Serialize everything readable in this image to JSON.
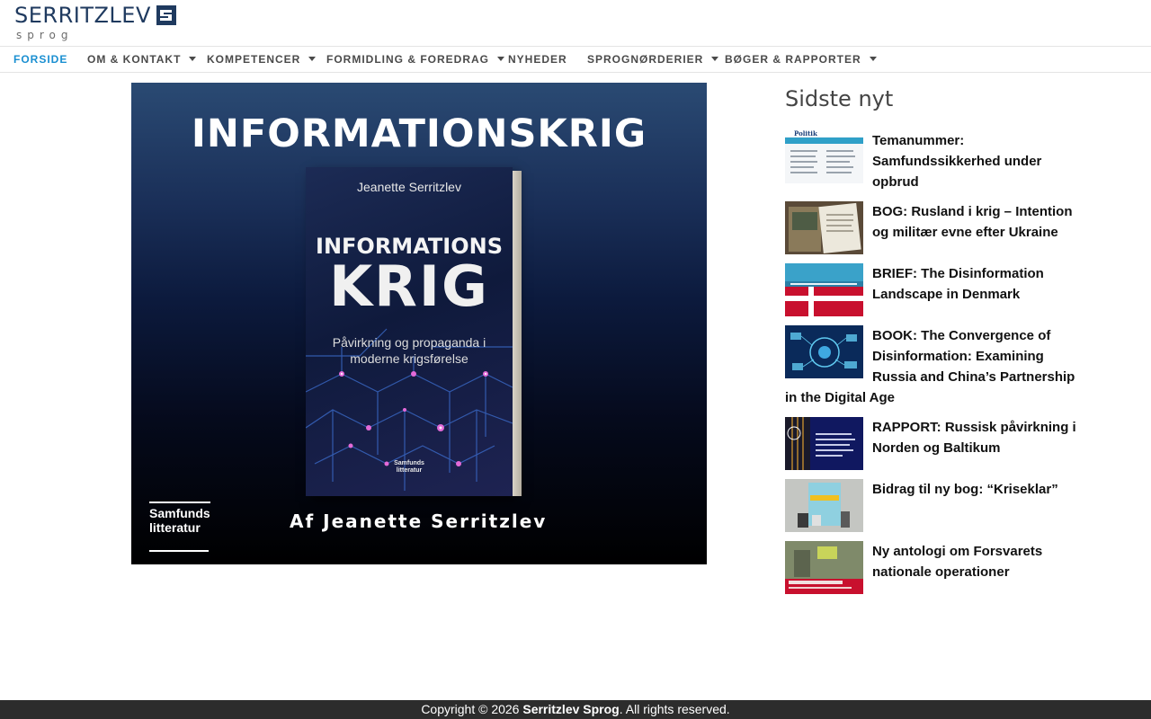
{
  "logo": {
    "main": "SERRITZLEV",
    "sub": "sprog",
    "mark": "brand-mark-icon",
    "colors": {
      "main": "#1f3a5f",
      "sub": "#6b6b6b"
    }
  },
  "nav": {
    "items": [
      {
        "label": "FORSIDE",
        "active": true,
        "has_dropdown": false
      },
      {
        "label": "OM & KONTAKT",
        "active": false,
        "has_dropdown": true
      },
      {
        "label": "KOMPETENCER",
        "active": false,
        "has_dropdown": true
      },
      {
        "label": "FORMIDLING & FOREDRAG",
        "active": false,
        "has_dropdown": true
      },
      {
        "label": "NYHEDER",
        "active": false,
        "has_dropdown": false
      },
      {
        "label": "SPROGNØRDERIER",
        "active": false,
        "has_dropdown": true
      },
      {
        "label": "BØGER & RAPPORTER",
        "active": false,
        "has_dropdown": true
      }
    ],
    "active_color": "#1a8fd1"
  },
  "hero": {
    "title": "INFORMATIONSKRIG",
    "book_author": "Jeanette Serritzlev",
    "book_title_1": "INFORMATIONS",
    "book_title_2": "KRIG",
    "book_subtitle": "Påvirkning og propaganda i moderne krigsførelse",
    "book_publisher": "Samfunds litteratur",
    "publisher_line_1": "Samfunds",
    "publisher_line_2": "litteratur",
    "byline": "Af Jeanette Serritzlev"
  },
  "sidebar": {
    "title": "Sidste nyt",
    "items": [
      {
        "title": "Temanummer: Samfundssikkerhed under opbrud",
        "thumb": "politik-journal-thumb"
      },
      {
        "title": "BOG: Rusland i krig – Intention og militær evne efter Ukraine",
        "thumb": "book-photo-thumb"
      },
      {
        "title": "BRIEF: The Disinformation Landscape in Denmark",
        "thumb": "danish-flag-thumb"
      },
      {
        "title": "BOOK: The Convergence of Disinformation: Examining Russia and China’s Partnership in the Digital Age",
        "thumb": "digital-network-thumb"
      },
      {
        "title": "RAPPORT: Russisk påvirkning i Norden og Baltikum",
        "thumb": "report-cover-thumb"
      },
      {
        "title": "Bidrag til ny bog: “Kriseklar”",
        "thumb": "kriseklar-book-thumb"
      },
      {
        "title": "Ny antologi om Forsvarets nationale operationer",
        "thumb": "hjemmefronten-book-thumb"
      }
    ]
  },
  "footer": {
    "prefix": "Copyright © 2026 ",
    "brand": "Serritzlev Sprog",
    "suffix": ". All rights reserved."
  }
}
